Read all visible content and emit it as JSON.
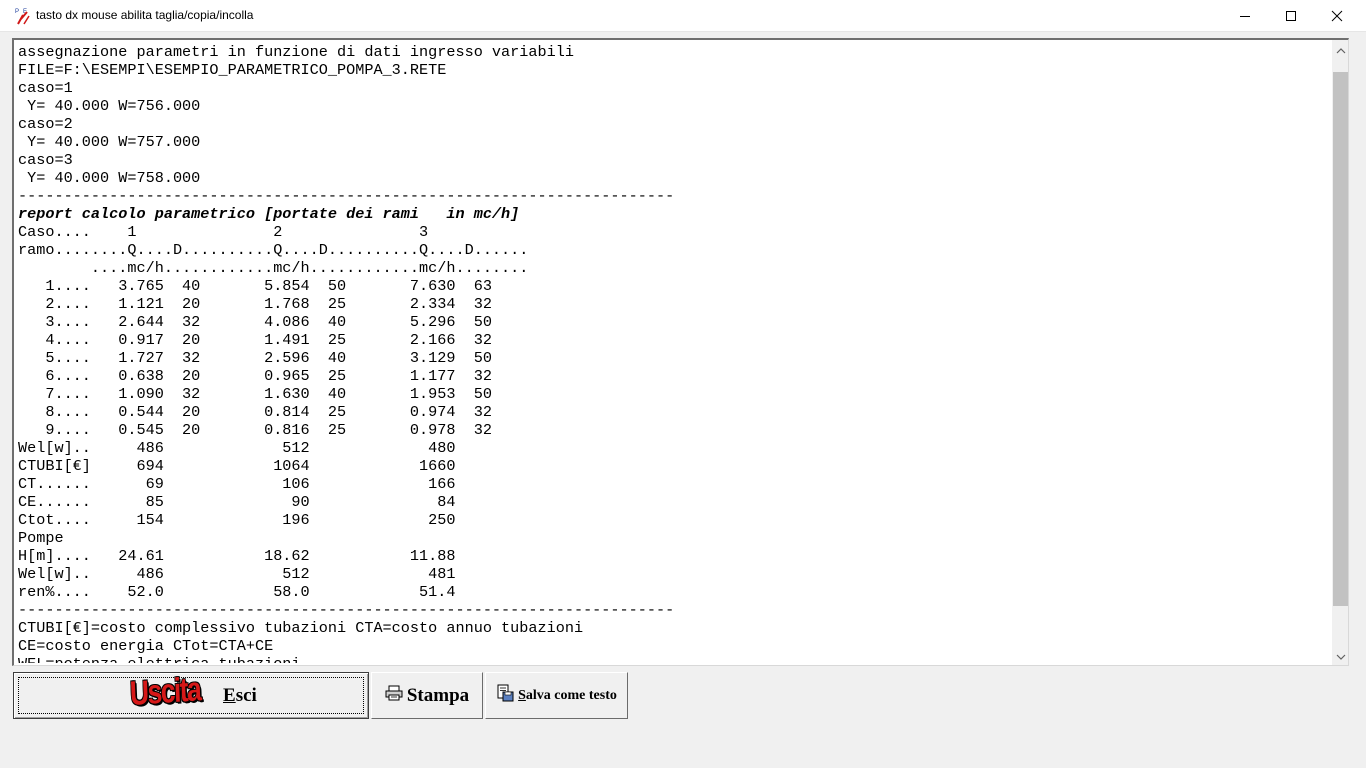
{
  "window": {
    "title": "tasto dx mouse abilita taglia/copia/incolla",
    "app_icon": "pipe-network-app-icon",
    "controls": [
      "minimize-icon",
      "maximize-icon",
      "close-icon"
    ]
  },
  "output_lines": [
    "assegnazione parametri in funzione di dati ingresso variabili",
    "FILE=F:\\ESEMPI\\ESEMPIO_PARAMETRICO_POMPA_3.RETE",
    "caso=1",
    " Y= 40.000 W=756.000",
    "caso=2",
    " Y= 40.000 W=757.000",
    "caso=3",
    " Y= 40.000 W=758.000",
    "------------------------------------------------------------------------",
    "report calcolo parametrico [portate dei rami   in mc/h]",
    "Caso....    1               2               3",
    "ramo........Q....D..........Q....D..........Q....D......",
    "        ....mc/h............mc/h............mc/h........",
    "   1....   3.765  40       5.854  50       7.630  63",
    "   2....   1.121  20       1.768  25       2.334  32",
    "   3....   2.644  32       4.086  40       5.296  50",
    "   4....   0.917  20       1.491  25       2.166  32",
    "   5....   1.727  32       2.596  40       3.129  50",
    "   6....   0.638  20       0.965  25       1.177  32",
    "   7....   1.090  32       1.630  40       1.953  50",
    "   8....   0.544  20       0.814  25       0.974  32",
    "   9....   0.545  20       0.816  25       0.978  32",
    "Wel[w]..     486             512             480",
    "CTUBI[€]     694            1064            1660",
    "CT......      69             106             166",
    "CE......      85              90              84",
    "Ctot....     154             196             250",
    "Pompe",
    "H[m]....   24.61           18.62           11.88",
    "Wel[w]..     486             512             481",
    "ren%....    52.0            58.0            51.4",
    "------------------------------------------------------------------------",
    "CTUBI[€]=costo complessivo tubazioni CTA=costo annuo tubazioni",
    "CE=costo energia CTot=CTA+CE",
    "WEL=potenza elettrica tubazioni"
  ],
  "bold_italic_line_index": 9,
  "buttons": {
    "esci": {
      "logo": "Uscita",
      "hotkey": "E",
      "rest": "sci"
    },
    "stampa": {
      "icon": "printer-icon",
      "label": "Stampa"
    },
    "salva": {
      "icon": "save-text-icon",
      "hotkey": "S",
      "rest": "alva come testo"
    }
  },
  "scrollbar": {
    "icons": [
      "chevron-up-icon",
      "chevron-down-icon"
    ]
  }
}
